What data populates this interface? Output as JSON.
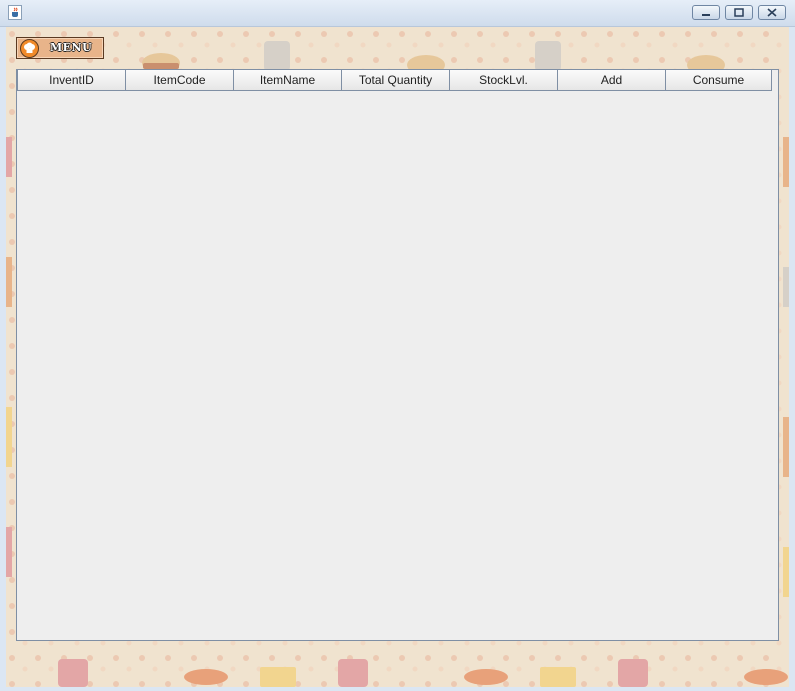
{
  "window": {
    "title": "",
    "app_icon": "java-cup-icon",
    "controls": [
      "minimize-icon",
      "maximize-icon",
      "close-icon"
    ]
  },
  "menu_button": {
    "label": "MENU",
    "icon": "chef-hat-icon"
  },
  "table": {
    "columns": [
      "InventID",
      "ItemCode",
      "ItemName",
      "Total Quantity",
      "StockLvl.",
      "Add",
      "Consume"
    ],
    "rows": []
  },
  "colors": {
    "background": "#f0e3cf",
    "menu_button": "#e8b48a",
    "table_body": "#eeeeee",
    "header": "#f2f2f2",
    "titlebar": "#dbe6f3"
  }
}
